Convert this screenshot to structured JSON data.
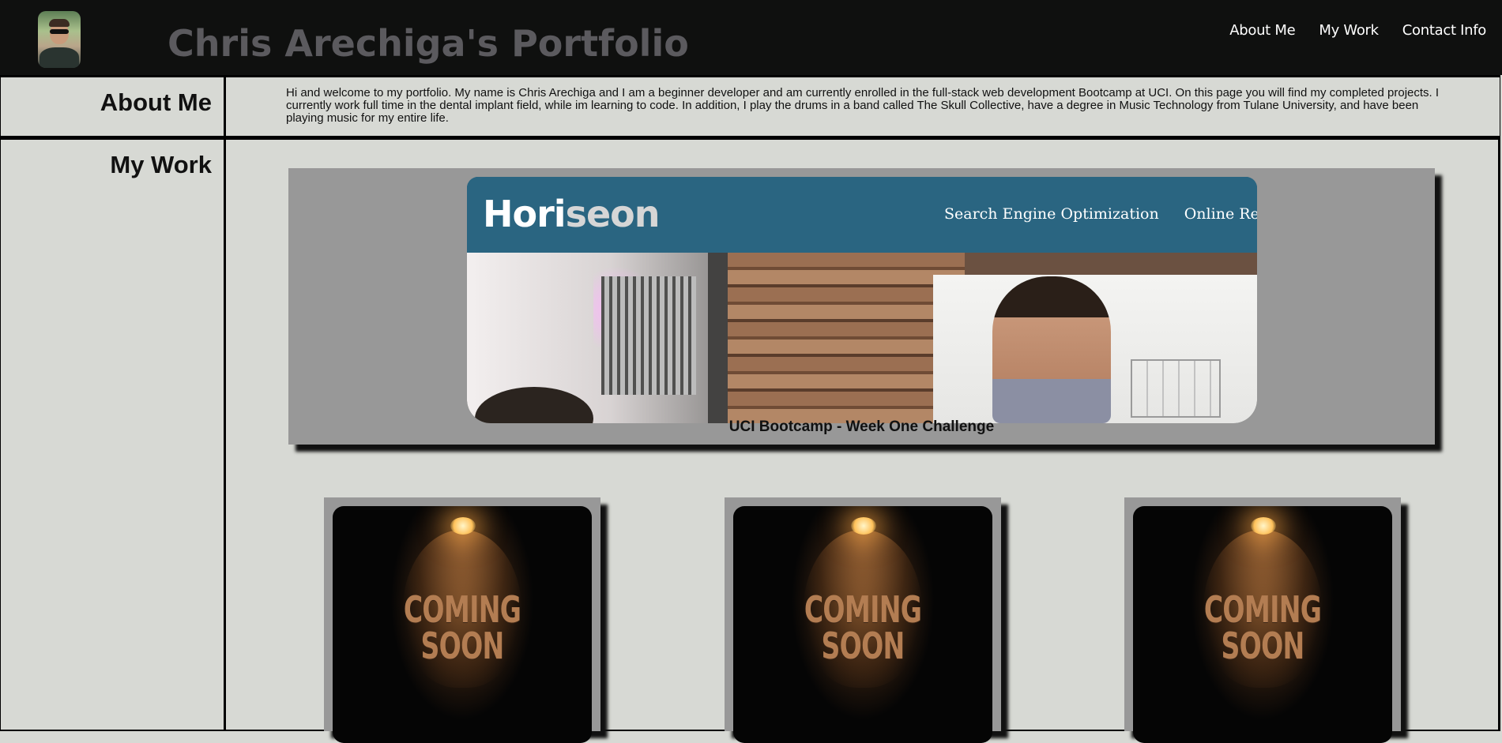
{
  "header": {
    "title": "Chris Arechiga's Portfolio",
    "nav": [
      {
        "label": "About Me"
      },
      {
        "label": "My Work"
      },
      {
        "label": "Contact Info"
      }
    ]
  },
  "about": {
    "heading": "About Me",
    "text": "Hi and welcome to my portfolio. My name is Chris Arechiga and I am a beginner developer and am currently enrolled in the full-stack web development Bootcamp at UCI. On this page you will find my completed projects. I currently work full time in the dental implant field, while im learning to code. In addition, I play the drums in a band called The Skull Collective, have a degree in Music Technology from Tulane University, and have been playing music for my entire life."
  },
  "work": {
    "heading": "My Work",
    "featured": {
      "brand_main": "Hori",
      "brand_accent": "seon",
      "nav": [
        "Search Engine Optimization",
        "Online Reputation"
      ],
      "caption": "UCI Bootcamp - Week One Challenge"
    },
    "coming_soon": [
      {
        "line1": "COMING",
        "line2": "SOON"
      },
      {
        "line1": "COMING",
        "line2": "SOON"
      },
      {
        "line1": "COMING",
        "line2": "SOON"
      }
    ]
  },
  "colors": {
    "header_bg": "#0f100f",
    "page_bg": "#d7d9d4",
    "title_gray": "#5b5a5e",
    "card_bg": "#989898",
    "horiseon_blue": "#2a6581"
  }
}
